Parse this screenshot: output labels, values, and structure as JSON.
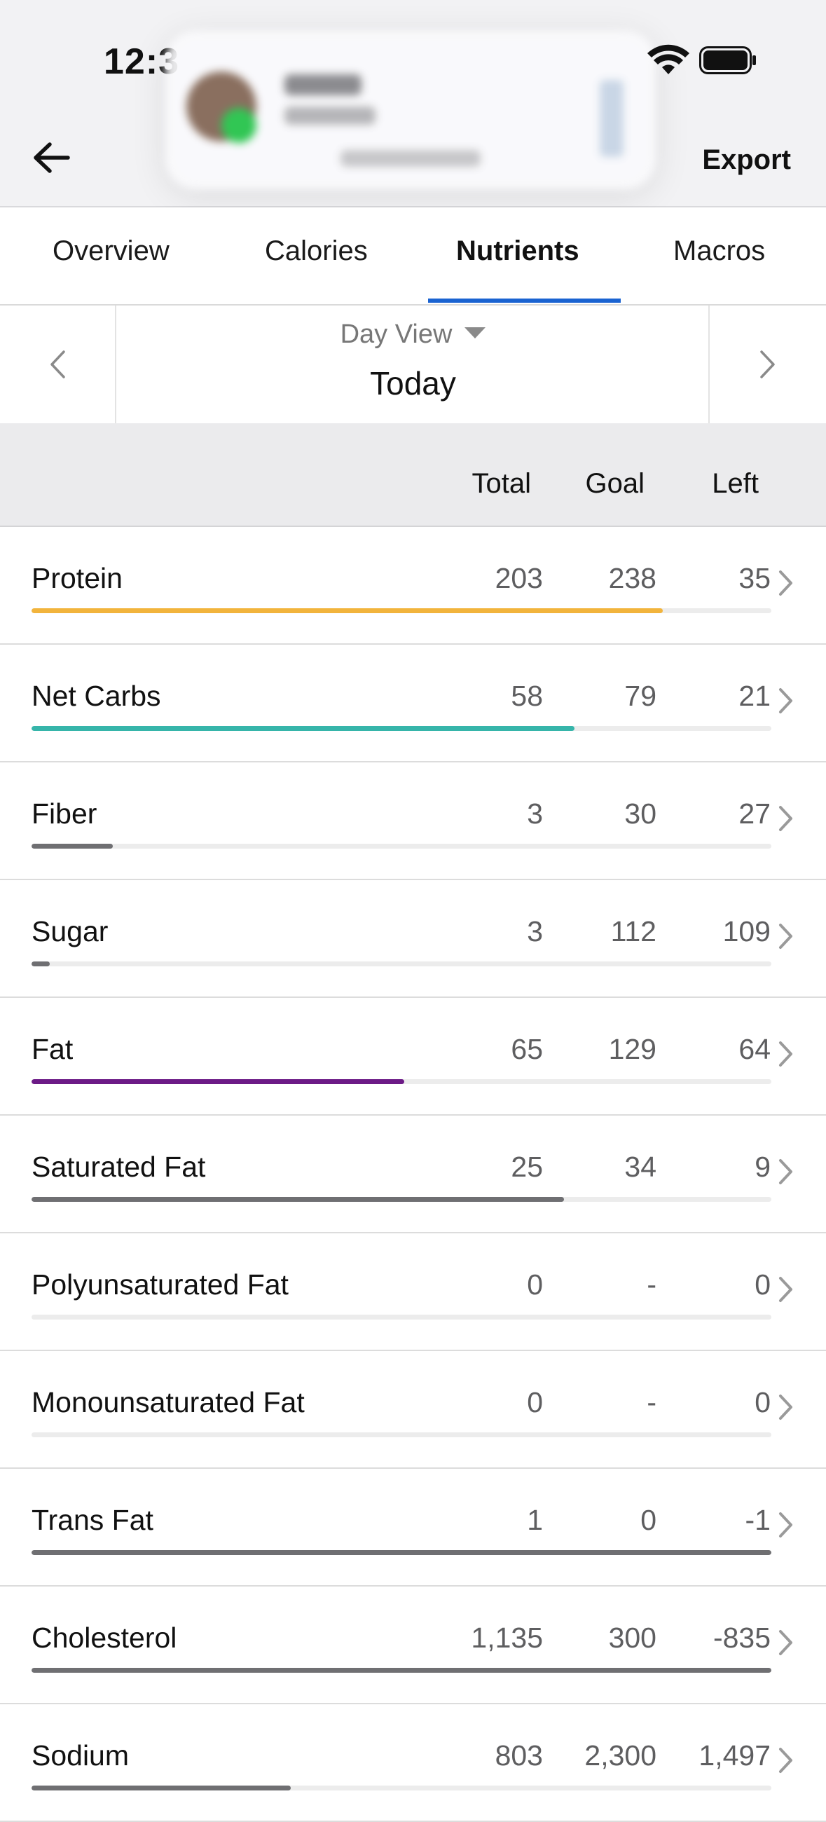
{
  "status_bar": {
    "time": "12:3"
  },
  "header": {
    "export_label": "Export"
  },
  "tabs": [
    {
      "label": "Overview",
      "active": false
    },
    {
      "label": "Calories",
      "active": false
    },
    {
      "label": "Nutrients",
      "active": true
    },
    {
      "label": "Macros",
      "active": false
    }
  ],
  "day_nav": {
    "view_mode": "Day View",
    "day": "Today"
  },
  "table_header": {
    "total": "Total",
    "goal": "Goal",
    "left": "Left"
  },
  "colors": {
    "accent_tab": "#1a63d1",
    "protein": "#f2b43c",
    "net_carbs": "#36b5aa",
    "fat": "#6c1a86",
    "default_bar": "#6f6f72",
    "track": "#ececec"
  },
  "nutrients": [
    {
      "name": "Protein",
      "total": "203",
      "goal": "238",
      "left": "35",
      "progress": 0.853,
      "color": "#f2b43c"
    },
    {
      "name": "Net Carbs",
      "total": "58",
      "goal": "79",
      "left": "21",
      "progress": 0.734,
      "color": "#36b5aa"
    },
    {
      "name": "Fiber",
      "total": "3",
      "goal": "30",
      "left": "27",
      "progress": 0.11,
      "color": "#6f6f72"
    },
    {
      "name": "Sugar",
      "total": "3",
      "goal": "112",
      "left": "109",
      "progress": 0.025,
      "color": "#6f6f72"
    },
    {
      "name": "Fat",
      "total": "65",
      "goal": "129",
      "left": "64",
      "progress": 0.504,
      "color": "#6c1a86"
    },
    {
      "name": "Saturated Fat",
      "total": "25",
      "goal": "34",
      "left": "9",
      "progress": 0.72,
      "color": "#6f6f72"
    },
    {
      "name": "Polyunsaturated Fat",
      "total": "0",
      "goal": "-",
      "left": "0",
      "progress": 0,
      "color": "#6f6f72"
    },
    {
      "name": "Monounsaturated Fat",
      "total": "0",
      "goal": "-",
      "left": "0",
      "progress": 0,
      "color": "#6f6f72"
    },
    {
      "name": "Trans Fat",
      "total": "1",
      "goal": "0",
      "left": "-1",
      "progress": 1,
      "color": "#6f6f72"
    },
    {
      "name": "Cholesterol",
      "total": "1,135",
      "goal": "300",
      "left": "-835",
      "progress": 1,
      "color": "#6f6f72"
    },
    {
      "name": "Sodium",
      "total": "803",
      "goal": "2,300",
      "left": "1,497",
      "progress": 0.35,
      "color": "#6f6f72"
    }
  ]
}
